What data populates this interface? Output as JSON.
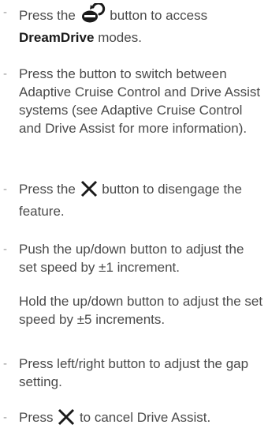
{
  "bullet": "-",
  "items": [
    {
      "before": "Press the",
      "icon": "dreamdrive-icon",
      "after": "button to access",
      "bold": "DreamDrive",
      "tail": "modes."
    },
    {
      "text": "Press the button to switch between Adaptive Cruise Control and Drive Assist systems (see Adaptive Cruise Control and Drive Assist for more information)."
    },
    {
      "before": "Press the",
      "icon": "close-x-icon",
      "after": "button to disengage the feature."
    },
    {
      "para1": "Push the up/down button to adjust the set speed by ±1 increment.",
      "para2": "Hold the up/down button to adjust the set speed by ±5 increments."
    },
    {
      "text": "Press left/right button to adjust the gap setting."
    },
    {
      "before": "Press",
      "icon": "close-x-icon",
      "after": "to cancel Drive Assist."
    }
  ],
  "colors": {
    "text": "#4a4a4a",
    "bold": "#1a1a1a",
    "icon": "#1a1a1a"
  }
}
